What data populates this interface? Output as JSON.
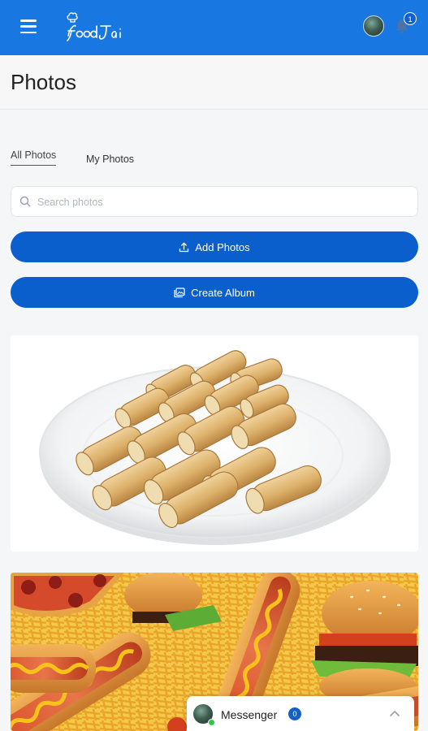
{
  "app": {
    "brand": "foodJai",
    "brand_color": "#1877e0",
    "notification_count": "1"
  },
  "icons": {
    "menu": "hamburger-icon",
    "notifications": "bell-icon",
    "search": "search-icon",
    "upload": "upload-icon",
    "album": "album-icon",
    "expand": "chevron-up-icon"
  },
  "page": {
    "title": "Photos"
  },
  "tabs": [
    {
      "label": "All Photos",
      "active": true
    },
    {
      "label": "My Photos",
      "active": false
    }
  ],
  "search": {
    "placeholder": "Search photos",
    "value": ""
  },
  "actions": {
    "add_photos": "Add Photos",
    "create_album": "Create Album",
    "button_color": "#0b5fcd"
  },
  "photos": [
    {
      "subject": "spring-rolls-on-plate"
    },
    {
      "subject": "hot-dogs-burgers-fries-pizza"
    }
  ],
  "messenger": {
    "label": "Messenger",
    "count": "0"
  }
}
